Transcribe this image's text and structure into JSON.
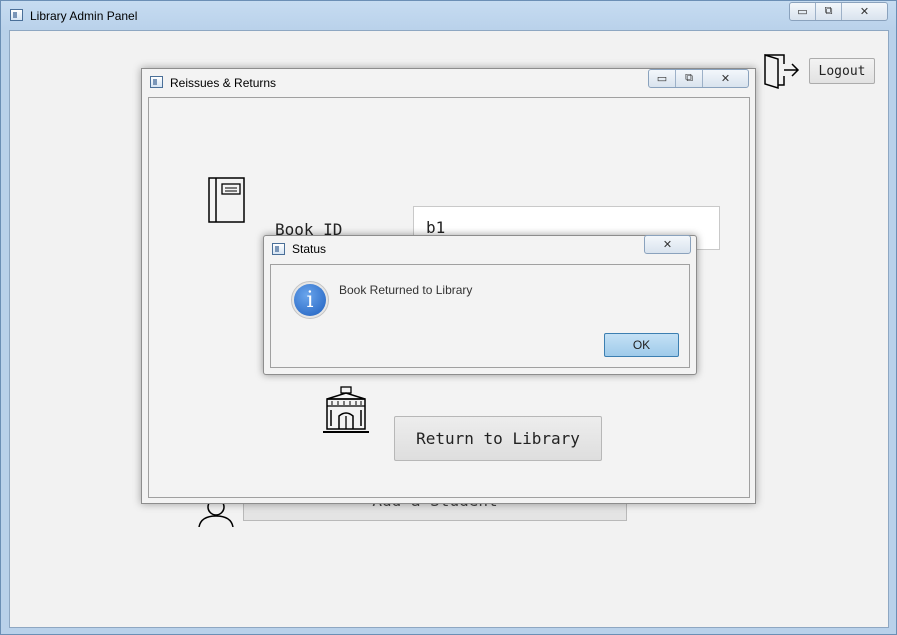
{
  "main_window": {
    "title": "Library Admin Panel",
    "controls": {
      "minimize": "▭",
      "maximize": "⧉",
      "close": "✕"
    }
  },
  "header": {
    "logout_label": "Logout"
  },
  "background": {
    "add_student_label": "Add a Student"
  },
  "reissue_dialog": {
    "title": "Reissues & Returns",
    "controls": {
      "minimize": "▭",
      "maximize": "⧉",
      "close": "✕"
    },
    "book_id_label": "Book ID",
    "book_id_value": "b1",
    "return_button_label": "Return to Library"
  },
  "status_dialog": {
    "title": "Status",
    "close": "✕",
    "message": "Book Returned to Library",
    "ok_label": "OK"
  },
  "colors": {
    "ok_button": "#a9d2ee",
    "title_bar": "#b9d1ea",
    "info_icon": "#2a6ccf"
  },
  "icons": {
    "logout": "door-exit-icon",
    "book": "book-icon",
    "library": "library-building-icon",
    "student": "student-icon",
    "info": "info-icon"
  }
}
